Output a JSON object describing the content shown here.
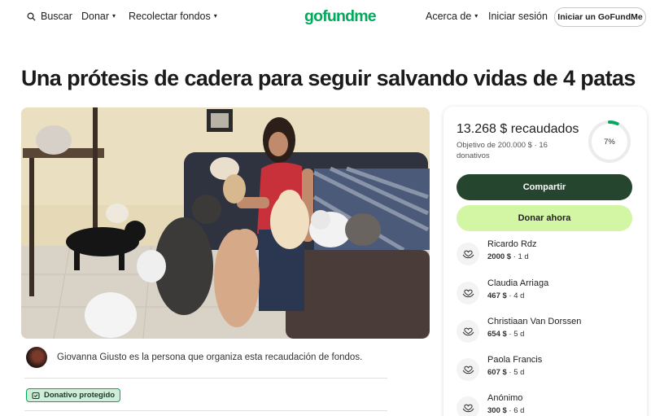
{
  "header": {
    "search_label": "Buscar",
    "donate_label": "Donar",
    "fundraise_label": "Recolectar fondos",
    "logo_text": "gofundme",
    "about_label": "Acerca de",
    "login_label": "Iniciar sesión",
    "start_label": "Iniciar un GoFundMe",
    "caret": "▾"
  },
  "campaign": {
    "title": "Una prótesis de cadera para seguir salvando vidas de 4 patas",
    "organizer_text": "Giovanna Giusto es la persona que organiza esta recaudación de fondos.",
    "protected_label": "Donativo protegido"
  },
  "progress": {
    "raised_text": "13.268 $ recaudados",
    "goal_text": "Objetivo de 200.000 $  ·  16 donativos",
    "percent_label": "7%",
    "fraction": 0.066
  },
  "actions": {
    "share_label": "Compartir",
    "donate_now_label": "Donar ahora"
  },
  "donations": [
    {
      "name": "Ricardo Rdz",
      "amount": "2000 $",
      "when": " · 1 d"
    },
    {
      "name": "Claudia Arriaga",
      "amount": "467 $",
      "when": " · 4 d"
    },
    {
      "name": "Christiaan Van Dorssen",
      "amount": "654 $",
      "when": " · 5 d"
    },
    {
      "name": "Paola Francis",
      "amount": "607 $",
      "when": " · 5 d"
    },
    {
      "name": "Anónimo",
      "amount": "300 $",
      "when": " · 6 d"
    }
  ],
  "colors": {
    "brand_green": "#02a95c",
    "share_button": "#26452f",
    "donate_button": "#d3f6a5",
    "protected_badge": "#cfeeda"
  },
  "icons": {
    "search": "search-icon",
    "shield": "shield-icon",
    "donor": "heart-hands-icon"
  }
}
